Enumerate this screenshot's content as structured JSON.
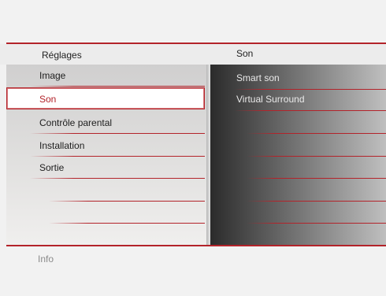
{
  "header": {
    "left_title": "Réglages",
    "right_title": "Son"
  },
  "menu": {
    "items": [
      {
        "label": "Image"
      },
      {
        "label": "Son",
        "selected": true
      },
      {
        "label": "Contrôle parental"
      },
      {
        "label": "Installation"
      },
      {
        "label": "Sortie"
      }
    ]
  },
  "options": {
    "items": [
      {
        "label": "Smart son"
      },
      {
        "label": "Virtual Surround"
      }
    ]
  },
  "footer": {
    "info": "Info"
  },
  "colors": {
    "accent": "#b3232a",
    "background": "#f1f1f1"
  }
}
